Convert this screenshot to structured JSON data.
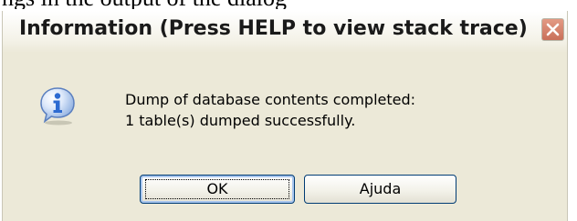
{
  "header_fragment": "ngs in the output of the dialog",
  "dialog": {
    "title": "Information (Press HELP to view stack trace)",
    "icon": "info-icon",
    "close_icon": "close-icon",
    "message_line1": "Dump of database contents completed:",
    "message_line2": "1 table(s) dumped successfully.",
    "ok_label": "OK",
    "help_label": "Ajuda"
  },
  "colors": {
    "dialog_background": "#ece9d8",
    "close_button": "#c9705a",
    "info_icon": "#2d6bd1",
    "button_border": "#003c74"
  }
}
